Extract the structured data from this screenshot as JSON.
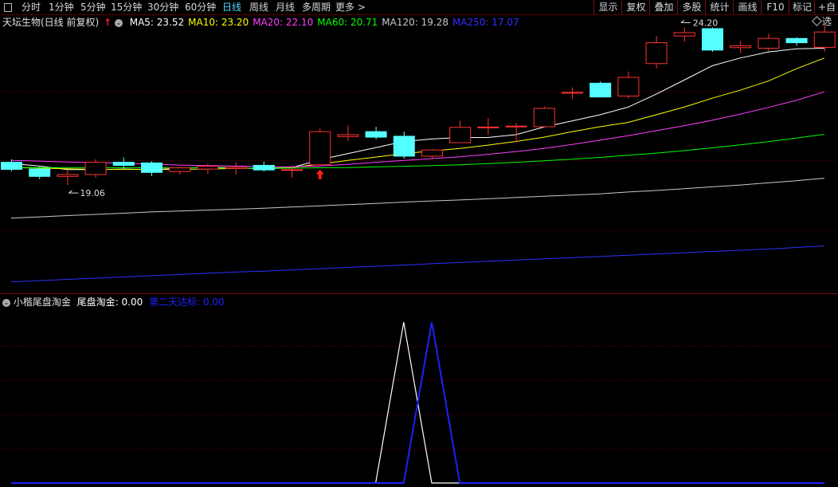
{
  "toolbar": {
    "periods": [
      "分时",
      "1分钟",
      "5分钟",
      "15分钟",
      "30分钟",
      "60分钟",
      "日线",
      "周线",
      "月线",
      "多周期",
      "更多"
    ],
    "more_arrow": ">",
    "active_period": "日线",
    "right_buttons": [
      "显示",
      "复权",
      "叠加",
      "多股",
      "统计",
      "画线",
      "F10",
      "标记",
      "+自选"
    ]
  },
  "main_chart": {
    "stock_title": "天坛生物(日线 前复权)",
    "ma_legend": [
      {
        "label": "MA5: 23.52",
        "color": "#ffffff"
      },
      {
        "label": "MA10: 23.20",
        "color": "#ffff00"
      },
      {
        "label": "MA20: 22.10",
        "color": "#ff40ff"
      },
      {
        "label": "MA60: 20.71",
        "color": "#00ff00"
      },
      {
        "label": "MA120: 19.28",
        "color": "#c8c8c8"
      },
      {
        "label": "MA250: 17.07",
        "color": "#3030ff"
      }
    ],
    "high_annotation": "24.20",
    "low_annotation": "19.06",
    "colors": {
      "up": "#ff3232",
      "down": "#54ffff",
      "grid": "#7a0000"
    }
  },
  "chart_data": [
    {
      "type": "candlestick",
      "ohlc_order": "open, high, low, close",
      "candles": [
        [
          19.8,
          19.9,
          19.5,
          19.57
        ],
        [
          19.58,
          19.65,
          19.25,
          19.34
        ],
        [
          19.34,
          19.55,
          19.06,
          19.4
        ],
        [
          19.4,
          19.9,
          19.3,
          19.8
        ],
        [
          19.8,
          19.96,
          19.6,
          19.7
        ],
        [
          19.78,
          19.84,
          19.35,
          19.47
        ],
        [
          19.5,
          19.65,
          19.4,
          19.62
        ],
        [
          19.58,
          19.75,
          19.42,
          19.67
        ],
        [
          19.6,
          19.8,
          19.4,
          19.64
        ],
        [
          19.7,
          19.82,
          19.5,
          19.55
        ],
        [
          19.55,
          19.7,
          19.3,
          19.56
        ],
        [
          19.72,
          20.9,
          19.72,
          20.8
        ],
        [
          20.64,
          21.0,
          20.5,
          20.7
        ],
        [
          20.8,
          20.96,
          20.55,
          20.62
        ],
        [
          20.65,
          20.8,
          19.92,
          20.0
        ],
        [
          20.0,
          20.24,
          19.9,
          20.2
        ],
        [
          20.44,
          21.16,
          20.44,
          20.94
        ],
        [
          20.95,
          21.24,
          20.7,
          20.95
        ],
        [
          20.96,
          21.08,
          20.45,
          20.98
        ],
        [
          20.96,
          21.62,
          20.96,
          21.56
        ],
        [
          22.06,
          22.24,
          21.88,
          22.08
        ],
        [
          22.38,
          22.44,
          21.93,
          21.93
        ],
        [
          21.96,
          22.76,
          21.88,
          22.57
        ],
        [
          23.02,
          23.92,
          22.86,
          23.7
        ],
        [
          23.92,
          24.2,
          23.73,
          24.03
        ],
        [
          24.16,
          24.2,
          23.4,
          23.46
        ],
        [
          23.54,
          23.76,
          23.36,
          23.6
        ],
        [
          23.52,
          24.0,
          23.42,
          23.84
        ],
        [
          23.84,
          23.88,
          23.6,
          23.7
        ],
        [
          23.55,
          24.26,
          23.4,
          24.05
        ]
      ],
      "ma_lines": {
        "MA5": [
          19.76,
          19.68,
          19.56,
          19.56,
          19.58,
          19.56,
          19.6,
          19.64,
          19.62,
          19.59,
          19.62,
          19.88,
          20.08,
          20.28,
          20.48,
          20.56,
          20.61,
          20.61,
          20.7,
          20.95,
          21.15,
          21.35,
          21.6,
          22.02,
          22.48,
          22.95,
          23.2,
          23.4,
          23.5,
          23.52
        ],
        "MA10": [
          19.63,
          19.61,
          19.59,
          19.57,
          19.57,
          19.56,
          19.57,
          19.58,
          19.6,
          19.61,
          19.63,
          19.74,
          19.86,
          19.97,
          20.08,
          20.17,
          20.25,
          20.36,
          20.48,
          20.62,
          20.8,
          20.96,
          21.1,
          21.35,
          21.6,
          21.89,
          22.15,
          22.45,
          22.85,
          23.2
        ],
        "MA20": [
          19.86,
          19.84,
          19.81,
          19.79,
          19.77,
          19.74,
          19.71,
          19.69,
          19.68,
          19.66,
          19.65,
          19.68,
          19.73,
          19.8,
          19.86,
          19.92,
          19.98,
          20.06,
          20.15,
          20.25,
          20.38,
          20.52,
          20.67,
          20.83,
          20.99,
          21.17,
          21.37,
          21.59,
          21.82,
          22.1
        ],
        "MA60": [
          19.63,
          19.63,
          19.63,
          19.63,
          19.62,
          19.62,
          19.62,
          19.62,
          19.61,
          19.61,
          19.61,
          19.62,
          19.63,
          19.65,
          19.67,
          19.69,
          19.72,
          19.76,
          19.8,
          19.85,
          19.9,
          19.96,
          20.03,
          20.1,
          20.18,
          20.27,
          20.37,
          20.47,
          20.59,
          20.71
        ],
        "MA120": [
          17.98,
          18.02,
          18.06,
          18.1,
          18.14,
          18.18,
          18.21,
          18.24,
          18.27,
          18.3,
          18.34,
          18.38,
          18.42,
          18.46,
          18.5,
          18.54,
          18.57,
          18.61,
          18.65,
          18.69,
          18.73,
          18.77,
          18.83,
          18.88,
          18.94,
          19.0,
          19.06,
          19.13,
          19.2,
          19.28
        ],
        "MA250": [
          15.9,
          15.94,
          15.98,
          16.02,
          16.06,
          16.1,
          16.14,
          16.18,
          16.22,
          16.25,
          16.29,
          16.33,
          16.37,
          16.41,
          16.45,
          16.49,
          16.53,
          16.57,
          16.61,
          16.65,
          16.69,
          16.73,
          16.77,
          16.81,
          16.85,
          16.89,
          16.93,
          16.97,
          17.02,
          17.07
        ]
      },
      "signal_arrow_indices": [
        11
      ],
      "high_marker_index": 24,
      "low_marker_index": 2,
      "ylim": [
        15.5,
        24.6
      ]
    },
    {
      "type": "line",
      "indicator": "小楷尾盘淘金",
      "series": [
        {
          "name": "尾盘淘金",
          "value_label": "0.00",
          "color": "#ffffff",
          "values": [
            0,
            0,
            0,
            0,
            0,
            0,
            0,
            0,
            0,
            0,
            0,
            0,
            0,
            0,
            1,
            0,
            0,
            0,
            0,
            0,
            0,
            0,
            0,
            0,
            0,
            0,
            0,
            0,
            0,
            0
          ]
        },
        {
          "name": "第二天达标",
          "value_label": "0.00",
          "color": "#2020ff",
          "values": [
            0,
            0,
            0,
            0,
            0,
            0,
            0,
            0,
            0,
            0,
            0,
            0,
            0,
            0,
            0,
            1,
            0,
            0,
            0,
            0,
            0,
            0,
            0,
            0,
            0,
            0,
            0,
            0,
            0,
            0
          ]
        }
      ],
      "ylim": [
        0,
        1.1
      ]
    }
  ]
}
